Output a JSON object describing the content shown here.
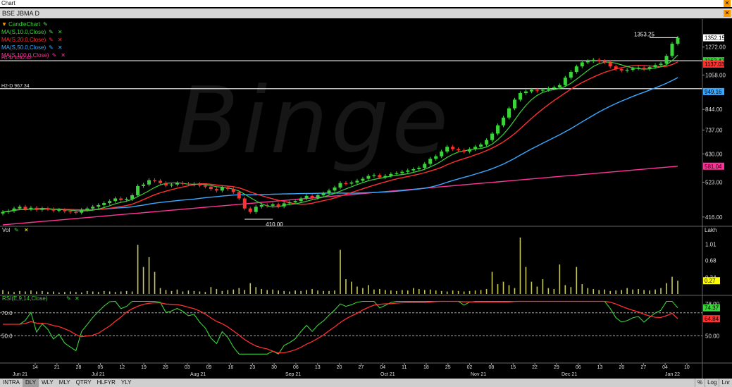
{
  "window": {
    "title": "Chart",
    "close_icon": "close-icon"
  },
  "symbol_bar": {
    "symbol": "BSE JBMA D"
  },
  "watermark": "Binge",
  "legend": {
    "items": [
      {
        "label": "CandleChart",
        "color": "#3cd23c"
      },
      {
        "label": "MA(S,10.0,Close)",
        "color": "#3cd23c"
      },
      {
        "label": "MA(S,20.0,Close)",
        "color": "#ff3030"
      },
      {
        "label": "MA(S,50.0,Close)",
        "color": "#3aa8ff"
      },
      {
        "label": "MA(S,100.0,Close)",
        "color": "#ff3399"
      }
    ],
    "h1_label": "H1-D 1162.42",
    "h2_label": "H2-D 967.34"
  },
  "panels": {
    "vol_label": "Vol",
    "vol_unit": "Lakh",
    "rsi_label": "RSI(E,9,14,Close)"
  },
  "annotations": {
    "high_label": "1353.25",
    "low_label": "410.00"
  },
  "price_badges": [
    {
      "value": "1352.15",
      "bg": "#ffffff",
      "fg": "#000000"
    },
    {
      "value": "1162.42",
      "bg": "#3cd23c",
      "fg": "#000000"
    },
    {
      "value": "1137.03",
      "bg": "#ff3030",
      "fg": "#000000"
    },
    {
      "value": "949.16",
      "bg": "#3aa8ff",
      "fg": "#000000"
    },
    {
      "value": "581.04",
      "bg": "#ff3399",
      "fg": "#000000"
    }
  ],
  "vol_badge": {
    "value": "0.27",
    "bg": "#ffff00",
    "fg": "#000000"
  },
  "rsi_badges": [
    {
      "value": "74.37",
      "bg": "#3cd23c"
    },
    {
      "value": "64.84",
      "bg": "#ff3030"
    }
  ],
  "bottom_tabs": [
    "INTRA",
    "DLY",
    "WLY",
    "MLY",
    "QTRY",
    "HLFYR",
    "YLY"
  ],
  "active_tab": "DLY",
  "bottom_right": [
    "%",
    "Log",
    "Lnr"
  ],
  "chart_data": {
    "type": "candlestick",
    "price_axis": {
      "ticks": [
        "1272.00",
        "1058.00",
        "844.00",
        "737.00",
        "630.00",
        "523.00",
        "416.00"
      ],
      "scale": "log"
    },
    "vol_axis": {
      "ticks": [
        "1.01",
        "0.68",
        "0.34"
      ],
      "unit": "Lakh"
    },
    "rsi_axis": {
      "ticks": [
        "78.00",
        "50.00"
      ],
      "levels": [
        "70.0",
        "50.0"
      ]
    },
    "x_ticks": [
      "14",
      "21",
      "28",
      "05",
      "12",
      "19",
      "26",
      "03",
      "09",
      "16",
      "23",
      "30",
      "06",
      "13",
      "20",
      "27",
      "04",
      "11",
      "18",
      "25",
      "02",
      "08",
      "15",
      "22",
      "29",
      "06",
      "13",
      "20",
      "27",
      "04",
      "10"
    ],
    "month_labels": [
      "Jun 21",
      "Jul 21",
      "Aug 21",
      "Sep 21",
      "Oct 21",
      "Nov 21",
      "Dec 21",
      "Jan 22"
    ],
    "close_prices": [
      430,
      433,
      440,
      445,
      438,
      442,
      436,
      440,
      438,
      434,
      436,
      432,
      430,
      428,
      436,
      440,
      445,
      450,
      456,
      462,
      470,
      465,
      468,
      480,
      510,
      515,
      530,
      528,
      520,
      512,
      515,
      520,
      518,
      515,
      517,
      512,
      508,
      500,
      495,
      505,
      500,
      490,
      470,
      440,
      430,
      445,
      450,
      448,
      452,
      446,
      455,
      458,
      462,
      470,
      478,
      472,
      480,
      486,
      495,
      505,
      520,
      518,
      522,
      528,
      535,
      545,
      548,
      540,
      545,
      552,
      555,
      560,
      565,
      570,
      575,
      590,
      610,
      620,
      640,
      660,
      650,
      645,
      640,
      650,
      660,
      670,
      690,
      720,
      760,
      800,
      850,
      900,
      940,
      950,
      960,
      955,
      960,
      970,
      975,
      990,
      1040,
      1080,
      1120,
      1150,
      1160,
      1170,
      1160,
      1150,
      1120,
      1100,
      1090,
      1095,
      1105,
      1110,
      1100,
      1115,
      1130,
      1140,
      1200,
      1300,
      1352
    ],
    "volumes": [
      0.08,
      0.05,
      0.04,
      0.06,
      0.05,
      0.07,
      0.05,
      0.06,
      0.04,
      0.05,
      0.03,
      0.04,
      0.05,
      0.04,
      0.03,
      0.06,
      0.05,
      0.04,
      0.06,
      0.05,
      0.04,
      0.05,
      0.06,
      0.05,
      1.0,
      0.55,
      0.75,
      0.45,
      0.12,
      0.08,
      0.06,
      0.09,
      0.05,
      0.07,
      0.06,
      0.05,
      0.04,
      0.14,
      0.1,
      0.06,
      0.08,
      0.09,
      0.12,
      0.08,
      0.22,
      0.14,
      0.1,
      0.08,
      0.09,
      0.07,
      0.06,
      0.05,
      0.07,
      0.06,
      0.08,
      0.1,
      0.07,
      0.06,
      0.06,
      0.07,
      0.9,
      0.3,
      0.25,
      0.15,
      0.12,
      0.18,
      0.09,
      0.1,
      0.08,
      0.07,
      0.06,
      0.08,
      0.07,
      0.12,
      0.1,
      0.08,
      0.09,
      0.07,
      0.06,
      0.05,
      0.07,
      0.06,
      0.05,
      0.06,
      0.07,
      0.08,
      0.1,
      0.45,
      0.2,
      0.25,
      0.18,
      0.12,
      1.15,
      0.55,
      0.25,
      0.15,
      0.3,
      0.12,
      0.1,
      0.6,
      0.18,
      0.14,
      0.55,
      0.2,
      0.12,
      0.1,
      0.08,
      0.09,
      0.06,
      0.07,
      0.08,
      0.12,
      0.09,
      0.1,
      0.08,
      0.07,
      0.09,
      0.12,
      0.22,
      0.35,
      0.27
    ],
    "rsi_value": 74.37,
    "rsi_signal": 64.84
  }
}
